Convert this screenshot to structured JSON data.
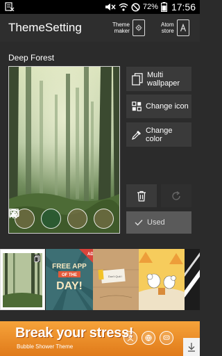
{
  "status_bar": {
    "battery": "72%",
    "time": "17:56"
  },
  "app_bar": {
    "title": "ThemeSetting",
    "theme_maker_label_1": "Theme",
    "theme_maker_label_2": "maker",
    "atom_store_label_1": "Atom",
    "atom_store_label_2": "store"
  },
  "theme": {
    "name": "Deep Forest"
  },
  "actions": {
    "multi_wallpaper_1": "Multi",
    "multi_wallpaper_2": "wallpaper",
    "change_icon": "Change icon",
    "change_color_1": "Change",
    "change_color_2": "color",
    "used": "Used"
  },
  "thumbnails": {
    "free_app_1": "FREE APP",
    "free_app_2": "OF THE",
    "free_app_3": "DAY!",
    "ad_badge": "AD",
    "note_text": "Don't Quit !"
  },
  "ad": {
    "title": "Break your stress!",
    "subtitle": "Bubble Shower Theme"
  },
  "colors": {
    "accent_orange": "#e88a25",
    "background": "#2b2b2b"
  }
}
